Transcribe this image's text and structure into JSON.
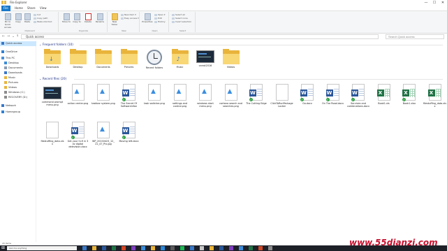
{
  "window": {
    "title": "File Explorer"
  },
  "window_controls": {
    "minimize": "—",
    "maximize": "☐",
    "close": "✕"
  },
  "tabs": [
    "File",
    "Home",
    "Share",
    "View"
  ],
  "ribbon": {
    "clipboard": {
      "pin": "Pin to Quick access",
      "copy": "Copy",
      "paste": "Paste",
      "cut": "Cut",
      "copy_path": "Copy path",
      "paste_shortcut": "Paste shortcut",
      "label": "Clipboard"
    },
    "organize": {
      "move_to": "Move to",
      "copy_to": "Copy to",
      "delete": "Delete",
      "rename": "Rename",
      "label": "Organize"
    },
    "new": {
      "new_folder": "New folder",
      "new_item": "New item ▾",
      "easy_access": "Easy access ▾",
      "label": "New"
    },
    "open": {
      "properties": "Properties",
      "open": "Open ▾",
      "edit": "Edit",
      "history": "History",
      "label": "Open"
    },
    "select": {
      "select_all": "Select all",
      "select_none": "Select none",
      "invert": "Invert selection",
      "label": "Select"
    }
  },
  "address": {
    "path": "Quick access",
    "search_placeholder": "Search Quick access"
  },
  "nav": {
    "items": [
      {
        "label": "Quick access",
        "icon": "star-icon",
        "selected": true
      },
      {
        "label": "OneDrive",
        "icon": "cloud-icon"
      },
      {
        "label": "This PC",
        "icon": "computer-icon"
      },
      {
        "label": "Desktop",
        "icon": "desktop-icon"
      },
      {
        "label": "Documents",
        "icon": "documents-icon"
      },
      {
        "label": "Downloads",
        "icon": "downloads-icon"
      },
      {
        "label": "Music",
        "icon": "music-icon"
      },
      {
        "label": "Pictures",
        "icon": "pictures-icon"
      },
      {
        "label": "Videos",
        "icon": "videos-icon"
      },
      {
        "label": "Windows (C:)",
        "icon": "drive-icon"
      },
      {
        "label": "RECOVERY (D:)",
        "icon": "drive-icon"
      },
      {
        "label": "Network",
        "icon": "network-icon"
      },
      {
        "label": "Homegroup",
        "icon": "homegroup-icon"
      }
    ]
  },
  "frequent": {
    "header": "Frequent folders (10)",
    "items": [
      {
        "label": "Downloads",
        "glyph": "↓"
      },
      {
        "label": "Desktop",
        "glyph": ""
      },
      {
        "label": "Documents",
        "glyph": ""
      },
      {
        "label": "Pictures",
        "glyph": ""
      },
      {
        "label": "Recent folders",
        "glyph": ""
      },
      {
        "label": "Music",
        "glyph": "♪"
      },
      {
        "label": "carrot2016",
        "glyph": ""
      },
      {
        "label": "Videos",
        "glyph": ""
      }
    ]
  },
  "recent": {
    "header": "Recent files (20)",
    "items": [
      {
        "label": "command prompt menu.png",
        "kind": "dark"
      },
      {
        "label": "action center.png",
        "kind": "image"
      },
      {
        "label": "taskbar system.png",
        "kind": "image"
      },
      {
        "label": "The Secret Of Softwareinfon",
        "kind": "word",
        "check": true
      },
      {
        "label": "task switcher.png",
        "kind": "image"
      },
      {
        "label": "settings and control.png",
        "kind": "image"
      },
      {
        "label": "windows start menu.png",
        "kind": "image"
      },
      {
        "label": "cortana search and searches.png",
        "kind": "image"
      },
      {
        "label": "The Cutting Edge",
        "kind": "word",
        "check": true
      },
      {
        "label": "ClickToRunPackageLocker",
        "kind": "blank"
      },
      {
        "label": "Go.docx",
        "kind": "word",
        "check": true
      },
      {
        "label": "On The Road.docx",
        "kind": "word",
        "check": true
      },
      {
        "label": "Services and combinations.docx",
        "kind": "word",
        "check": true
      },
      {
        "label": "Book1.xls",
        "kind": "excel"
      },
      {
        "label": "Book1.xlsx",
        "kind": "excel",
        "check": true
      },
      {
        "label": "filestuffing_data.xlsx",
        "kind": "excel"
      },
      {
        "label": "filestuffing_data.xlsx",
        "kind": "blank"
      },
      {
        "label": "Get your hi-fi in 3 ez digital delevision.docx",
        "kind": "word",
        "check": true
      },
      {
        "label": "WP_20150423_12_22_47_Pro.jpg",
        "kind": "image"
      },
      {
        "label": "Moving left.docx",
        "kind": "word",
        "check": true
      }
    ]
  },
  "status": {
    "text": "20 items"
  },
  "taskbar": {
    "search": "Ask me anything"
  },
  "watermark": "www.55dianzi.com",
  "colors": {
    "accent": "#1979ca",
    "folder": "#e9b43b",
    "word": "#2b579a",
    "excel": "#217346",
    "taskbar": "#1d2027",
    "watermark": "#c8102e"
  }
}
